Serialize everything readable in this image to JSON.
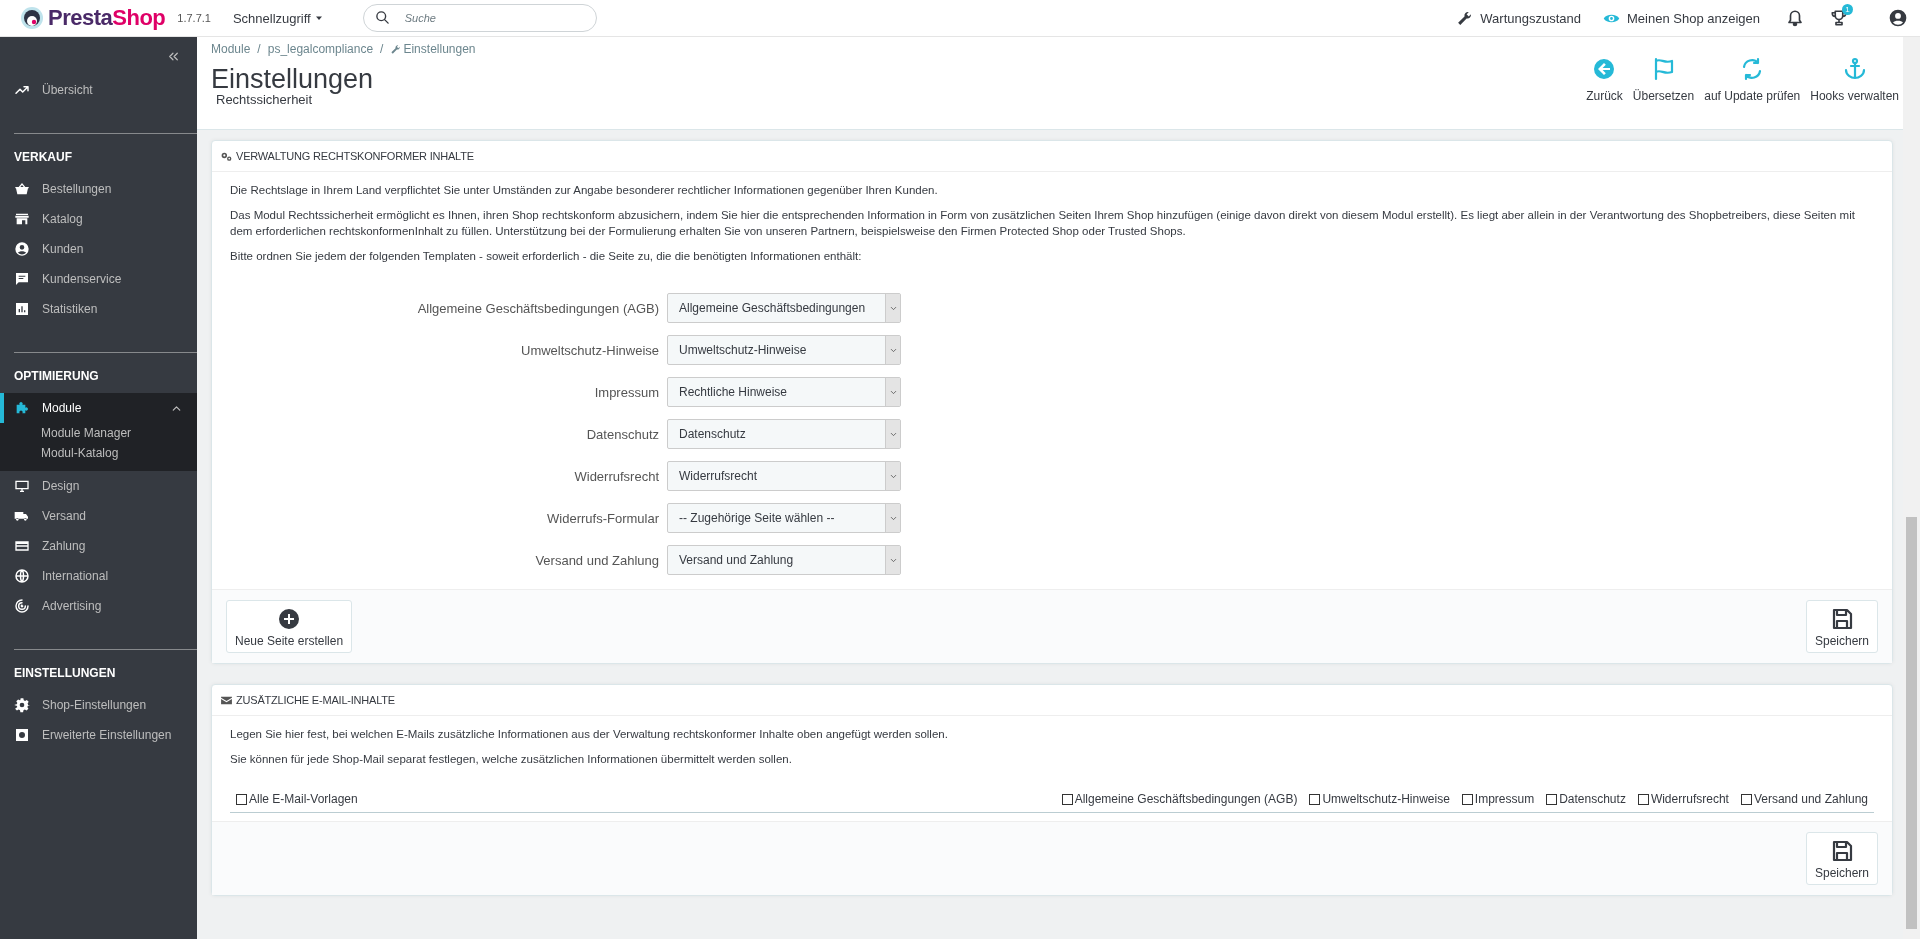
{
  "topbar": {
    "logo_part1": "Presta",
    "logo_part2": "Shop",
    "version": "1.7.7.1",
    "quick_access": "Schnellzugriff",
    "search": {
      "placeholder": "Suche"
    },
    "maintenance": "Wartungszustand",
    "view_shop": "Meinen Shop anzeigen",
    "badge": "1"
  },
  "sidebar": {
    "top_items": [
      {
        "label": "Übersicht",
        "selected": false
      }
    ],
    "sections": [
      {
        "title": "VERKAUF",
        "items": [
          {
            "label": "Bestellungen",
            "selected": false
          },
          {
            "label": "Katalog",
            "selected": false
          },
          {
            "label": "Kunden",
            "selected": false
          },
          {
            "label": "Kundenservice",
            "selected": false
          },
          {
            "label": "Statistiken",
            "selected": false
          }
        ]
      },
      {
        "title": "OPTIMIERUNG",
        "items": [
          {
            "label": "Module",
            "selected": true,
            "expanded": true,
            "children": [
              {
                "label": "Module Manager",
                "selected": false
              },
              {
                "label": "Modul-Katalog",
                "selected": false
              }
            ]
          },
          {
            "label": "Design",
            "selected": false
          },
          {
            "label": "Versand",
            "selected": false
          },
          {
            "label": "Zahlung",
            "selected": false
          },
          {
            "label": "International",
            "selected": false
          },
          {
            "label": "Advertising",
            "selected": false
          }
        ]
      },
      {
        "title": "EINSTELLUNGEN",
        "items": [
          {
            "label": "Shop-Einstellungen",
            "selected": false
          },
          {
            "label": "Erweiterte Einstellungen",
            "selected": false
          }
        ]
      }
    ]
  },
  "breadcrumb": [
    "Module",
    "/",
    "ps_legalcompliance",
    "/",
    "Einstellungen"
  ],
  "page": {
    "title": "Einstellungen",
    "subtitle": "Rechtssicherheit"
  },
  "toolbar": [
    "Zurück",
    "Übersetzen",
    "auf Update prüfen",
    "Hooks verwalten"
  ],
  "panel_content": {
    "title": "VERWALTUNG RECHTSKONFORMER INHALTE",
    "paragraphs": [
      "Die Rechtslage in Ihrem Land verpflichtet Sie unter Umständen zur Angabe besonderer rechtlicher Informationen gegenüber Ihren Kunden.",
      "Das Modul Rechtssicherheit ermöglicht es Ihnen, ihren Shop rechtskonform abzusichern, indem Sie hier die entsprechenden Information in Form von zusätzlichen Seiten Ihrem Shop hinzufügen (einige davon direkt von diesem Modul erstellt). Es liegt aber allein in der Verantwortung des Shopbetreibers, diese Seiten mit dem erforderlichen rechtskonformenInhalt zu füllen. Unterstützung bei der Formulierung erhalten Sie von unseren Partnern, beispielsweise den Firmen Protected Shop oder Trusted Shops.",
      "Bitte ordnen Sie jedem der folgenden Templaten - soweit erforderlich - die Seite zu, die die benötigten Informationen enthält:"
    ],
    "fields": [
      {
        "label": "Allgemeine Geschäftsbedingungen (AGB)",
        "value": "Allgemeine Geschäftsbedingungen"
      },
      {
        "label": "Umweltschutz-Hinweise",
        "value": "Umweltschutz-Hinweise"
      },
      {
        "label": "Impressum",
        "value": "Rechtliche Hinweise"
      },
      {
        "label": "Datenschutz",
        "value": "Datenschutz"
      },
      {
        "label": "Widerrufsrecht",
        "value": "Widerrufsrecht"
      },
      {
        "label": "Widerrufs-Formular",
        "value": "-- Zugehörige Seite wählen --"
      },
      {
        "label": "Versand und Zahlung",
        "value": "Versand und Zahlung"
      }
    ],
    "new_page_button": "Neue Seite erstellen",
    "save_button": "Speichern"
  },
  "panel_email": {
    "title": "ZUSÄTZLICHE E-MAIL-INHALTE",
    "paragraphs": [
      "Legen Sie hier fest, bei welchen E-Mails zusätzliche Informationen aus der Verwaltung rechtskonformer Inhalte oben angefügt werden sollen.",
      "Sie können für jede Shop-Mail separat festlegen, welche zusätzlichen Informationen übermittelt werden sollen."
    ],
    "all_templates": {
      "label": "Alle E-Mail-Vorlagen",
      "checked": false
    },
    "options": [
      {
        "label": "Allgemeine Geschäftsbedingungen (AGB)",
        "checked": false
      },
      {
        "label": "Umweltschutz-Hinweise",
        "checked": false
      },
      {
        "label": "Impressum",
        "checked": false
      },
      {
        "label": "Datenschutz",
        "checked": false
      },
      {
        "label": "Widerrufsrecht",
        "checked": false
      },
      {
        "label": "Versand und Zahlung",
        "checked": false
      }
    ],
    "save_button": "Speichern"
  }
}
